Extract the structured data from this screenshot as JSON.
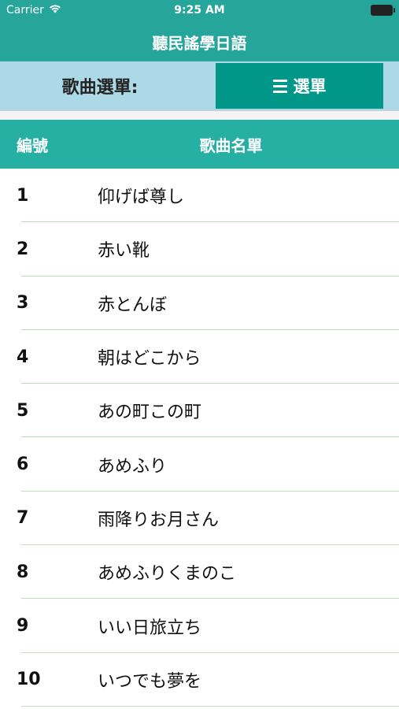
{
  "status_bar": {
    "carrier": "Carrier",
    "time": "9:25 AM"
  },
  "nav": {
    "title": "聽民謠學日語"
  },
  "selector": {
    "label": "歌曲選單:",
    "menu_button": "選單"
  },
  "table": {
    "header_number": "編號",
    "header_name": "歌曲名單",
    "rows": [
      {
        "num": "1",
        "title": "仰げば尊し"
      },
      {
        "num": "2",
        "title": "赤い靴"
      },
      {
        "num": "3",
        "title": "赤とんぼ"
      },
      {
        "num": "4",
        "title": "朝はどこから"
      },
      {
        "num": "5",
        "title": "あの町この町"
      },
      {
        "num": "6",
        "title": "あめふり"
      },
      {
        "num": "7",
        "title": "雨降りお月さん"
      },
      {
        "num": "8",
        "title": "あめふりくまのこ"
      },
      {
        "num": "9",
        "title": "いい日旅立ち"
      },
      {
        "num": "10",
        "title": "いつでも夢を"
      }
    ]
  },
  "colors": {
    "teal": "#26a69a",
    "light_blue": "#add8e6",
    "button_teal": "#009688",
    "divider": "#b9e2b9"
  }
}
